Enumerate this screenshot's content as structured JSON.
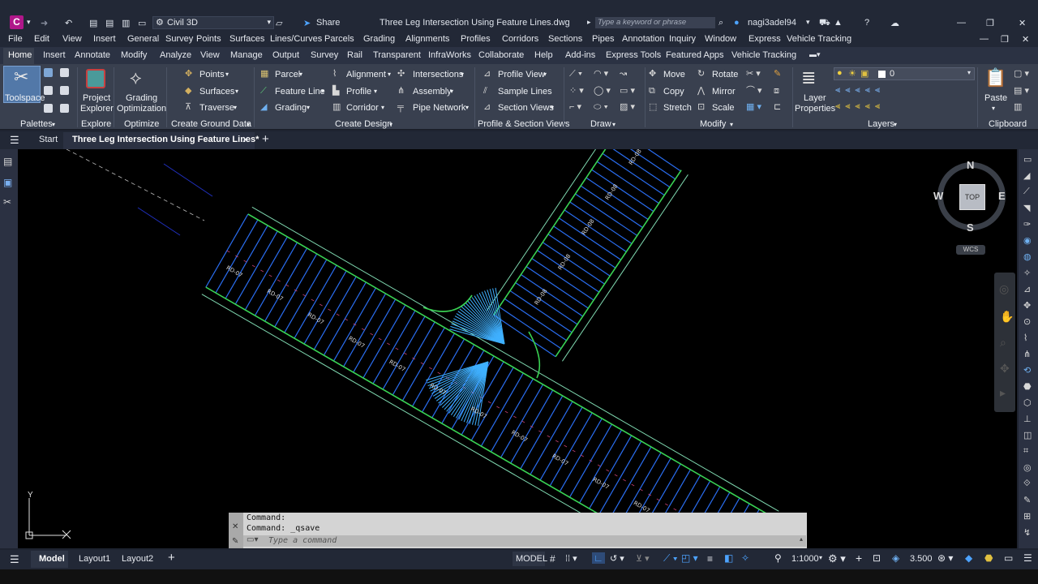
{
  "title_bar": {
    "app_logo": "C",
    "workspace": "Civil 3D",
    "share": "Share",
    "document_title": "Three Leg Intersection Using Feature Lines.dwg",
    "search_placeholder": "Type a keyword or phrase",
    "username": "nagi3adel94",
    "accent_color": "#b0178a"
  },
  "menu_bar": [
    "File",
    "Edit",
    "View",
    "Insert",
    "General",
    "Survey",
    "Points",
    "Surfaces",
    "Lines/Curves",
    "Parcels",
    "Grading",
    "Alignments",
    "Profiles",
    "Corridors",
    "Sections",
    "Pipes",
    "Annotation",
    "Inquiry",
    "Window",
    "Express",
    "Vehicle Tracking"
  ],
  "ribbon_tabs": {
    "active": "Home",
    "items": [
      "Home",
      "Insert",
      "Annotate",
      "Modify",
      "Analyze",
      "View",
      "Manage",
      "Output",
      "Survey",
      "Rail",
      "Transparent",
      "InfraWorks",
      "Collaborate",
      "Help",
      "Add-ins",
      "Express Tools",
      "Featured Apps",
      "Vehicle Tracking"
    ]
  },
  "ribbon": {
    "palettes": {
      "toolspace": "Toolspace",
      "panel": "Palettes"
    },
    "explore": {
      "button1": "Project",
      "button2": "Explorer",
      "panel": "Explore"
    },
    "optimize": {
      "button1": "Grading",
      "button2": "Optimization",
      "panel": "Optimize"
    },
    "ground": {
      "points": "Points",
      "surfaces": "Surfaces",
      "traverse": "Traverse",
      "panel": "Create Ground Data"
    },
    "design": {
      "parcel": "Parcel",
      "feature_line": "Feature Line",
      "grading": "Grading",
      "alignment": "Alignment",
      "profile": "Profile",
      "corridor": "Corridor",
      "intersections": "Intersections",
      "assembly": "Assembly",
      "pipe_network": "Pipe Network",
      "panel": "Create Design"
    },
    "profile_section": {
      "profile_view": "Profile View",
      "sample_lines": "Sample Lines",
      "section_views": "Section Views",
      "panel": "Profile & Section Views"
    },
    "draw": {
      "panel": "Draw"
    },
    "modify": {
      "move": "Move",
      "rotate": "Rotate",
      "copy": "Copy",
      "mirror": "Mirror",
      "stretch": "Stretch",
      "scale": "Scale",
      "panel": "Modify"
    },
    "layers": {
      "layer_properties1": "Layer",
      "layer_properties2": "Properties",
      "current_layer": "0",
      "panel": "Layers"
    },
    "clipboard": {
      "paste": "Paste",
      "panel": "Clipboard"
    }
  },
  "doc_tabs": {
    "start": "Start",
    "active": "Three Leg Intersection Using Feature Lines*"
  },
  "viewcube": {
    "n": "N",
    "s": "S",
    "e": "E",
    "w": "W",
    "face": "TOP",
    "ucs": "WCS"
  },
  "ucs_icon": {
    "y": "Y"
  },
  "command_line": {
    "history": [
      "Command:",
      "Command: _qsave"
    ],
    "placeholder": "Type a command"
  },
  "status_bar": {
    "layout_tabs": [
      "Model",
      "Layout1",
      "Layout2"
    ],
    "space": "MODEL",
    "scale": "1:1000",
    "annotation_scale": "3.500"
  },
  "drawing": {
    "label_road": "RD-07",
    "label_branch": "RD-08",
    "colors": {
      "edge": "#39d353",
      "rib": "#2a6df0",
      "rib_light": "#3fb0ff",
      "frame": "#7fd8b0",
      "label": "#dcdcdc"
    }
  }
}
